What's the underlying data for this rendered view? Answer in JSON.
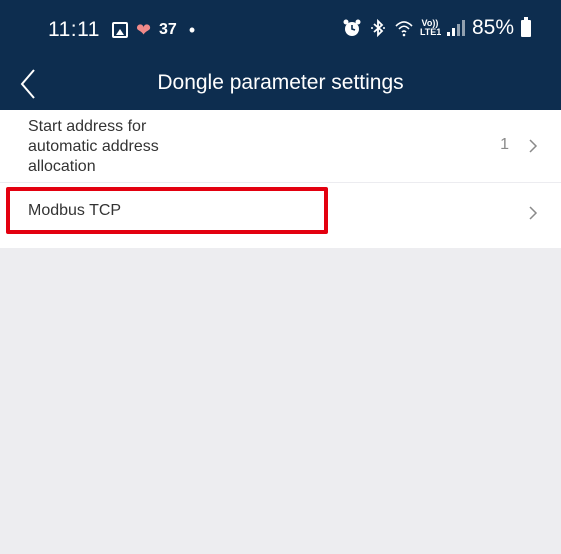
{
  "status_bar": {
    "time": "11:11",
    "notification_count": "37",
    "battery_percent": "85%",
    "lte_label_top": "Vo))",
    "lte_label_bottom": "LTE1",
    "icons": [
      "gallery-icon",
      "heart-icon",
      "dot-icon",
      "alarm-icon",
      "bluetooth-icon",
      "wifi-icon",
      "signal-icon",
      "battery-icon"
    ]
  },
  "header": {
    "title": "Dongle parameter settings",
    "back_icon": "chevron-left-icon"
  },
  "settings": {
    "items": [
      {
        "label": "Start address for automatic address allocation",
        "value": "1",
        "icon": "chevron-right-icon"
      },
      {
        "label": "Modbus TCP",
        "value": "",
        "icon": "chevron-right-icon"
      }
    ]
  },
  "highlight": {
    "target": "Modbus TCP",
    "color": "#e3000f"
  },
  "colors": {
    "header_bg": "#0d2d4f",
    "background": "#ededf0",
    "text_primary": "#333333",
    "text_secondary": "#8a8a8a"
  }
}
